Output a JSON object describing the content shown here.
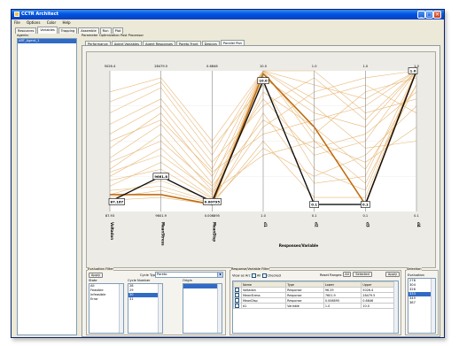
{
  "window": {
    "title": "CCTR Architect"
  },
  "menu": [
    "File",
    "Options",
    "Color",
    "Help"
  ],
  "main_tabs": [
    "Resources",
    "Variables",
    "Trapping",
    "Assemble",
    "Run",
    "Plot"
  ],
  "agents": {
    "label": "Agents:",
    "items": [
      "ART_Agent_1"
    ]
  },
  "panel_title": "Parameter Optimization Post Processor",
  "sub_tabs": [
    "Performance",
    "Agent Variables",
    "Agent Responses",
    "Pareto Front",
    "Designs",
    "Parallel Plot"
  ],
  "chart_data": {
    "type": "line",
    "title": "",
    "xlabel": "Responses/Variable",
    "axes": [
      {
        "name": "Voltadon",
        "top": "5026.4",
        "bottom": "87.93",
        "value_label": "87.167"
      },
      {
        "name": "MeanStress",
        "top": "28479.5",
        "bottom": "9601.9",
        "value_label": "9661.8"
      },
      {
        "name": "MeanDisp",
        "top": "0.6846",
        "bottom": "0.006895",
        "value_label": "0.00795"
      },
      {
        "name": "d1",
        "top": "10.0",
        "bottom": "1.0",
        "value_label": "10.0"
      },
      {
        "name": "d2",
        "top": "1.0",
        "bottom": "0.1",
        "value_label": "0.1"
      },
      {
        "name": "d3",
        "top": "1.0",
        "bottom": "0.1",
        "value_label": "0.1"
      },
      {
        "name": "d4",
        "top": "1.0",
        "bottom": "0.1",
        "value_label": "1.0"
      }
    ],
    "highlight_series": [
      0.07,
      0.25,
      0.07,
      0.93,
      0.05,
      0.05,
      1.0
    ],
    "bold_series": [
      0.12,
      0.12,
      0.05,
      0.98,
      0.6,
      0.05,
      1.0
    ],
    "background_series": [
      [
        0.12,
        0.22,
        0.08,
        1.0,
        0.5,
        0.35,
        0.6
      ],
      [
        0.18,
        0.35,
        0.1,
        0.95,
        0.7,
        0.6,
        1.0
      ],
      [
        0.25,
        0.45,
        0.12,
        1.0,
        0.9,
        0.8,
        1.0
      ],
      [
        0.3,
        0.55,
        0.15,
        0.85,
        0.6,
        0.3,
        0.9
      ],
      [
        0.38,
        0.62,
        0.2,
        1.0,
        1.0,
        0.7,
        0.8
      ],
      [
        0.45,
        0.7,
        0.25,
        0.8,
        0.4,
        0.5,
        1.0
      ],
      [
        0.55,
        0.75,
        0.3,
        1.0,
        0.8,
        0.9,
        0.7
      ],
      [
        0.62,
        0.8,
        0.35,
        0.75,
        0.95,
        0.65,
        1.0
      ],
      [
        0.7,
        0.88,
        0.4,
        1.0,
        0.55,
        0.85,
        0.95
      ],
      [
        0.78,
        0.92,
        0.45,
        0.9,
        0.3,
        0.15,
        1.0
      ],
      [
        0.85,
        0.95,
        0.5,
        1.0,
        0.75,
        0.45,
        0.5
      ],
      [
        0.1,
        0.15,
        0.06,
        0.7,
        0.2,
        0.25,
        1.0
      ],
      [
        0.22,
        0.3,
        0.09,
        0.6,
        0.85,
        0.95,
        1.0
      ],
      [
        0.35,
        0.5,
        0.18,
        0.65,
        0.45,
        0.55,
        0.85
      ],
      [
        0.5,
        0.65,
        0.28,
        0.55,
        0.65,
        0.75,
        1.0
      ],
      [
        0.08,
        0.1,
        0.05,
        0.5,
        0.1,
        0.1,
        1.0
      ],
      [
        0.15,
        0.18,
        0.07,
        0.45,
        0.25,
        0.4,
        0.75
      ],
      [
        0.28,
        0.4,
        0.14,
        0.4,
        0.5,
        0.2,
        0.9
      ]
    ],
    "colors": {
      "highlight": "#111111",
      "bold": "#c06d10",
      "background": "#e8b878"
    }
  },
  "evaluation_filter": {
    "title": "Evaluation Filter",
    "apply_label": "Apply",
    "cycle_type_label": "Cycle Type",
    "cycle_type_value": "Pareto",
    "state_label": "State",
    "state_items": [
      "All",
      "Feasible",
      "Infeasible",
      "Error"
    ],
    "cycle_number_label": "Cycle Number",
    "cycle_numbers": [
      "28",
      "29",
      "30",
      "31"
    ],
    "origin_label": "Origin"
  },
  "response_filter": {
    "title": "Response/Variable Filter",
    "view_as_label": "View as Arc",
    "view_all_label": "All",
    "checked_label": "Checked",
    "reset_ranges_label": "Reset Ranges",
    "all_button": "All",
    "selected_button": "Selected",
    "apply_label": "Apply",
    "columns": [
      "",
      "Name",
      "Type",
      "Lower",
      "Upper"
    ],
    "rows": [
      [
        "Voltadon",
        "Response",
        "96.29",
        "5026.4"
      ],
      [
        "MeanStress",
        "Response",
        "7601.9",
        "28479.5"
      ],
      [
        "MeanDisp",
        "Response",
        "0.006895",
        "0.6846"
      ],
      [
        "d1",
        "Variable",
        "1.0",
        "10.0"
      ]
    ]
  },
  "selection": {
    "title": "Selection",
    "evaluation_label": "Evaluation",
    "items": [
      "276",
      "304",
      "326",
      "333",
      "349",
      "387"
    ],
    "selected_index": 3
  }
}
